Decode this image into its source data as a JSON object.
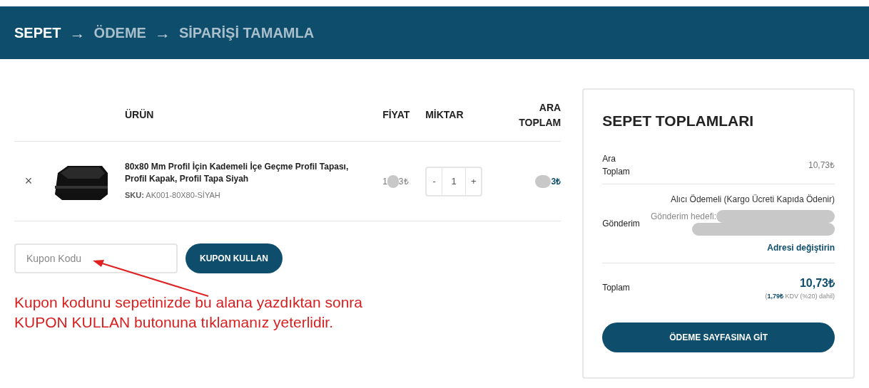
{
  "breadcrumb": [
    {
      "label": "SEPET",
      "selected": true
    },
    {
      "label": "→",
      "kind": "separator"
    },
    {
      "label": "ÖDEME",
      "selected": false
    },
    {
      "label": "→",
      "kind": "separator"
    },
    {
      "label": "SİPARİŞİ TAMAMLA",
      "selected": false
    }
  ],
  "table": {
    "columns": [
      "ÜRÜN",
      "FİYAT",
      "MİKTAR",
      "ARA TOPLAM"
    ],
    "rows": [
      {
        "remove": "×",
        "name": "80x80 Mm Profil İçin Kademeli İçe Geçme Profil Tapası, Profil Kapak, Profil Tapa Siyah",
        "sku_label": "SKU:",
        "sku": "AK001-80X80-SİYAH",
        "price_start": "1",
        "price_end": "3₺",
        "minus": "-",
        "quantity": "1",
        "plus": "+",
        "subtotal_end": "3₺"
      }
    ]
  },
  "coupon": {
    "placeholder": "Kupon Kodu",
    "button": "KUPON KULLAN"
  },
  "annotation": {
    "lines": [
      "Kupon kodunu sepetinizde bu alana yazdıktan sonra",
      "KUPON KULLAN butonuna tıklamanız yeterlidir."
    ]
  },
  "totals": {
    "title": "SEPET TOPLAMLARI",
    "subtotal_label": "Ara Toplam",
    "subtotal": "10,73₺",
    "shipping_label": "Gönderim",
    "shipping_method": "Alıcı Ödemeli (Kargo Ücreti Kapıda Ödenir)",
    "destination_label": "Gönderim hedefi:",
    "change_address": "Adresi değiştirin",
    "total_label": "Toplam",
    "total": "10,73₺",
    "tax_open": "(",
    "tax_amount": "1,79₺",
    "tax_rest": " KDV (%20) dahil)",
    "checkout": "ÖDEME SAYFASINA GİT"
  }
}
